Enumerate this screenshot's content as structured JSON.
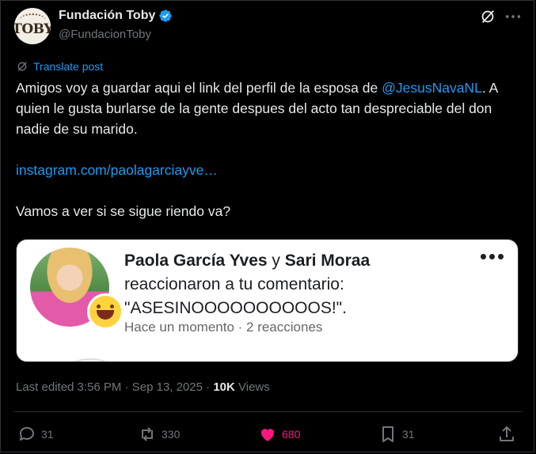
{
  "author": {
    "name": "Fundación Toby",
    "handle": "@FundacionToby",
    "avatar_text": "TOBY",
    "verified_color": "#1d9bf0"
  },
  "translate_label": "Translate post",
  "post": {
    "line1_prefix": "Amigos voy a guardar aqui el link del perfil de la esposa de",
    "mention": "@JesusNavaNL",
    "line1_suffix": ". A quien le gusta burlarse de la gente despues del acto tan despreciable del don nadie de su marido.",
    "url": "instagram.com/paolagarciayve…",
    "closing": "Vamos a ver si se sigue riendo va?"
  },
  "media": {
    "name1": "Paola García Yves",
    "connector": " y ",
    "name2": "Sari Moraa",
    "reaction_text": "reaccionaron a tu comentario:",
    "comment": "\"ASESINOOOOOOOOOOS!\".",
    "time_text": "Hace un momento · 2 reacciones"
  },
  "meta": {
    "edited": "Last edited 3:56 PM · Sep 13, 2025 · ",
    "views_count": "10K",
    "views_label": " Views"
  },
  "actions": {
    "replies": "31",
    "reposts": "330",
    "likes": "680",
    "bookmarks": "31"
  },
  "colors": {
    "accent": "#1d9bf0",
    "like": "#f91880",
    "muted": "#71767b"
  }
}
